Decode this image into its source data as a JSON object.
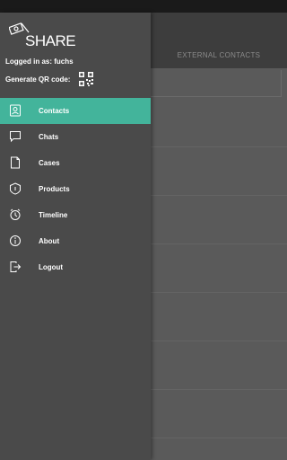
{
  "app": {
    "logo_text": "SHARE"
  },
  "user": {
    "logged_in_label": "Logged in as: fuchs",
    "qr_label": "Generate QR code:"
  },
  "background": {
    "tab_label": "EXTERNAL CONTACTS"
  },
  "nav": {
    "items": [
      {
        "label": "Contacts",
        "icon": "contacts-icon",
        "active": true
      },
      {
        "label": "Chats",
        "icon": "chat-icon",
        "active": false
      },
      {
        "label": "Cases",
        "icon": "cases-icon",
        "active": false
      },
      {
        "label": "Products",
        "icon": "products-icon",
        "active": false
      },
      {
        "label": "Timeline",
        "icon": "timeline-icon",
        "active": false
      },
      {
        "label": "About",
        "icon": "info-icon",
        "active": false
      },
      {
        "label": "Logout",
        "icon": "logout-icon",
        "active": false
      }
    ]
  },
  "colors": {
    "accent": "#43b49b",
    "drawer": "#4a4a4a",
    "overlay": "#5a5a5a"
  }
}
